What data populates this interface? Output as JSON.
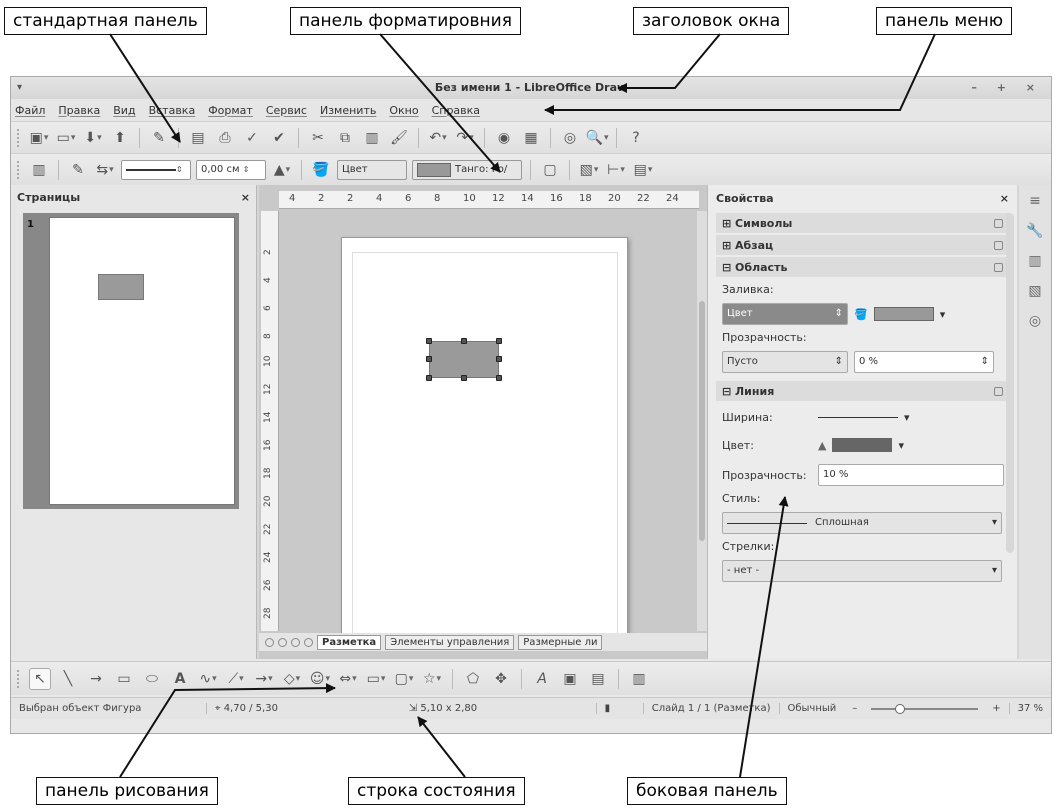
{
  "callouts": {
    "standard_toolbar": "стандартная панель",
    "formatting_toolbar": "панель форматировния",
    "window_title": "заголовок окна",
    "menu_bar": "панель меню",
    "drawing_toolbar": "панель рисования",
    "status_bar": "строка состояния",
    "sidebar": "боковая панель"
  },
  "window": {
    "title": "Без имени 1 - LibreOffice Draw",
    "controls": "– + ×"
  },
  "menu": [
    "Файл",
    "Правка",
    "Вид",
    "Вставка",
    "Формат",
    "Сервис",
    "Изменить",
    "Окно",
    "Справка"
  ],
  "formatting": {
    "line_width": "0,00 см",
    "fill_type": "Цвет",
    "fill_color": "Танго: Го/"
  },
  "pages_panel": {
    "title": "Страницы",
    "close": "×",
    "page_number": "1"
  },
  "ruler": {
    "h_ticks": [
      "4",
      "2",
      "2",
      "4",
      "6",
      "8",
      "10",
      "12",
      "14",
      "16",
      "18",
      "20",
      "22",
      "24"
    ],
    "v_ticks": [
      "2",
      "4",
      "6",
      "8",
      "10",
      "12",
      "14",
      "16",
      "18",
      "20",
      "22",
      "24",
      "26",
      "28"
    ]
  },
  "sheet_tabs": [
    "Разметка",
    "Элементы управления",
    "Размерные ли"
  ],
  "sidebar": {
    "title": "Свойства",
    "close": "×",
    "sections": {
      "symbols": "Символы",
      "paragraph": "Абзац",
      "area": "Область",
      "line": "Линия"
    },
    "fill_label": "Заливка:",
    "fill_value": "Цвет",
    "transparency_label": "Прозрачность:",
    "transparency_mode": "Пусто",
    "transparency_value": "0 %",
    "width_label": "Ширина:",
    "color_label": "Цвет:",
    "line_transparency_label": "Прозрачность:",
    "line_transparency_value": "10 %",
    "style_label": "Стиль:",
    "style_value": "Сплошная",
    "arrows_label": "Стрелки:",
    "arrows_value": "- нет -"
  },
  "status": {
    "selection": "Выбран объект Фигура",
    "position": "4,70 / 5,30",
    "size": "5,10 x 2,80",
    "slide": "Слайд 1 / 1 (Разметка)",
    "mode": "Обычный",
    "zoom": "37 %"
  },
  "colors": {
    "shape_fill": "#9a9a9a",
    "window_bg": "#e8e8e8",
    "callout_border": "#111111"
  }
}
